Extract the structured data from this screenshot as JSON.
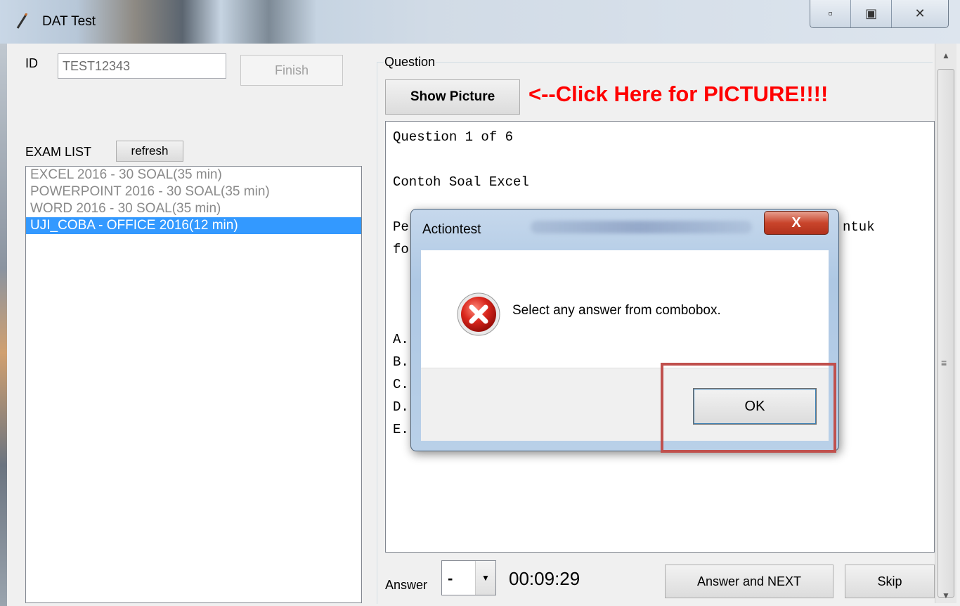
{
  "window": {
    "title": "DAT Test",
    "icon": "pencil-icon"
  },
  "left": {
    "id_label": "ID",
    "id_value": "TEST12343",
    "finish_label": "Finish",
    "exam_list_label": "EXAM LIST",
    "refresh_label": "refresh",
    "exams": [
      "EXCEL 2016 - 30 SOAL(35 min)",
      "POWERPOINT 2016 - 30 SOAL(35 min)",
      "WORD 2016 - 30 SOAL(35 min)",
      "UJI_COBA - OFFICE 2016(12 min)"
    ],
    "selected_exam_index": 3
  },
  "question": {
    "group_label": "Question",
    "show_picture_label": "Show Picture",
    "hint": "<--Click Here for PICTURE!!!!",
    "hint_color": "#ff0000",
    "lines": [
      "Question 1 of 6",
      "",
      "Contoh Soal Excel",
      "",
      "Pe",
      "fo",
      "",
      "",
      "",
      "A.",
      "B.",
      "C.",
      "D.",
      "E."
    ],
    "line_suffix": "ntuk"
  },
  "footer": {
    "answer_label": "Answer",
    "answer_value": "-",
    "timer": "00:09:29",
    "next_label": "Answer and NEXT",
    "skip_label": "Skip"
  },
  "dialog": {
    "title": "Actiontest",
    "message": "Select any answer from combobox.",
    "ok_label": "OK",
    "close_symbol": "X",
    "icon": "error-icon"
  },
  "colors": {
    "selection": "#3399ff",
    "highlight_box": "#c0504d"
  }
}
